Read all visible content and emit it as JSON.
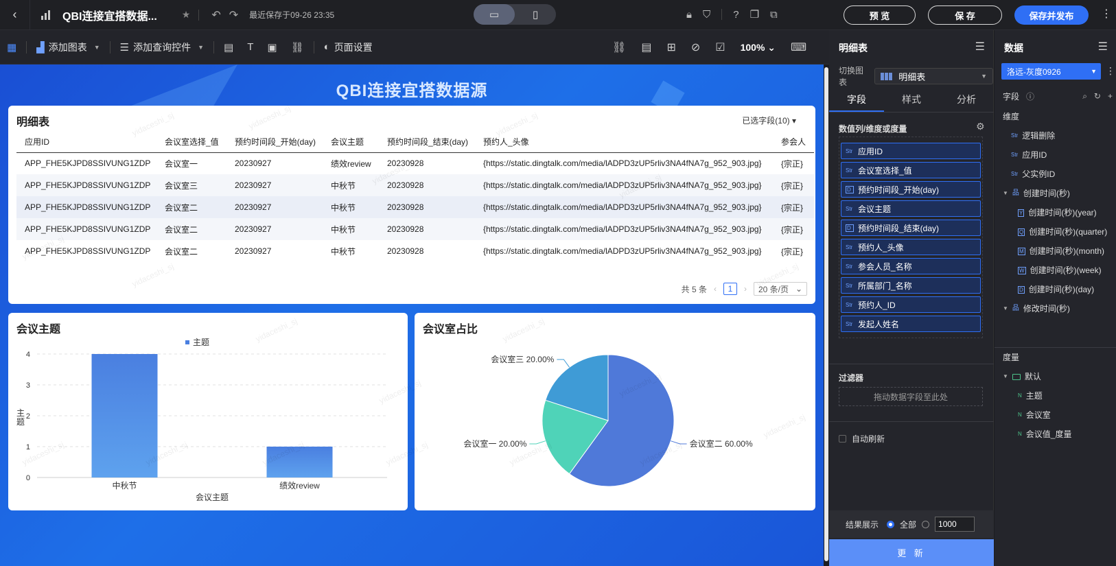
{
  "topbar": {
    "title": "QBI连接宜搭数据...",
    "saved_text": "最近保存于09-26 23:35",
    "preview_label": "预 览",
    "save_label": "保 存",
    "publish_label": "保存并发布"
  },
  "toolbar": {
    "add_chart": "添加图表",
    "add_query": "添加查询控件",
    "page_settings": "页面设置",
    "zoom": "100%"
  },
  "canvas": {
    "title": "QBI连接宜搭数据源",
    "watermark": "yidaceshi_sj"
  },
  "detail_table": {
    "title": "明细表",
    "selected_fields": "已选字段(10)",
    "columns": [
      "应用ID",
      "会议室选择_值",
      "预约时间段_开始(day)",
      "会议主题",
      "预约时间段_结束(day)",
      "预约人_头像",
      "参会人"
    ],
    "rows": [
      [
        "APP_FHE5KJPD8SSIVUNG1ZDP",
        "会议室一",
        "20230927",
        "绩效review",
        "20230928",
        "{https://static.dingtalk.com/media/lADPD3zUP5rliv3NA4fNA7g_952_903.jpg}",
        "{宗正}"
      ],
      [
        "APP_FHE5KJPD8SSIVUNG1ZDP",
        "会议室三",
        "20230927",
        "中秋节",
        "20230928",
        "{https://static.dingtalk.com/media/lADPD3zUP5rliv3NA4fNA7g_952_903.jpg}",
        "{宗正}"
      ],
      [
        "APP_FHE5KJPD8SSIVUNG1ZDP",
        "会议室二",
        "20230927",
        "中秋节",
        "20230928",
        "{https://static.dingtalk.com/media/lADPD3zUP5rliv3NA4fNA7g_952_903.jpg}",
        "{宗正}"
      ],
      [
        "APP_FHE5KJPD8SSIVUNG1ZDP",
        "会议室二",
        "20230927",
        "中秋节",
        "20230928",
        "{https://static.dingtalk.com/media/lADPD3zUP5rliv3NA4fNA7g_952_903.jpg}",
        "{宗正}"
      ],
      [
        "APP_FHE5KJPD8SSIVUNG1ZDP",
        "会议室二",
        "20230927",
        "中秋节",
        "20230928",
        "{https://static.dingtalk.com/media/lADPD3zUP5rliv3NA4fNA7g_952_903.jpg}",
        "{宗正}"
      ]
    ],
    "total_text": "共 5 条",
    "current_page": "1",
    "page_size": "20 条/页"
  },
  "chart_data": [
    {
      "type": "bar",
      "title": "会议主题",
      "categories": [
        "中秋节",
        "绩效review"
      ],
      "series": [
        {
          "name": "主题",
          "values": [
            4,
            1
          ]
        }
      ],
      "xlabel": "会议主题",
      "ylabel": "主题",
      "ylim": [
        0,
        4
      ],
      "yticks": [
        0,
        1,
        2,
        3,
        4
      ],
      "grid": true,
      "legend": "top-center",
      "color": "#4a7fe0"
    },
    {
      "type": "pie",
      "title": "会议室占比",
      "slices": [
        {
          "label": "会议室二",
          "value": 60,
          "display": "会议室二 60.00%",
          "color": "#4f79d9"
        },
        {
          "label": "会议室一",
          "value": 20,
          "display": "会议室一 20.00%",
          "color": "#4fd3b8"
        },
        {
          "label": "会议室三",
          "value": 20,
          "display": "会议室三 20.00%",
          "color": "#3f9bd6"
        }
      ]
    }
  ],
  "config_panel": {
    "title": "明细表",
    "switch_label": "切换图表",
    "chart_type": "明细表",
    "tabs": [
      "字段",
      "样式",
      "分析"
    ],
    "section_fields": "数值列/维度或度量",
    "fields": [
      {
        "type": "Str",
        "name": "应用ID"
      },
      {
        "type": "Str",
        "name": "会议室选择_值"
      },
      {
        "type": "D",
        "name": "预约时间段_开始(day)"
      },
      {
        "type": "Str",
        "name": "会议主题"
      },
      {
        "type": "D",
        "name": "预约时间段_结束(day)"
      },
      {
        "type": "Str",
        "name": "预约人_头像"
      },
      {
        "type": "Str",
        "name": "参会人员_名称"
      },
      {
        "type": "Str",
        "name": "所属部门_名称"
      },
      {
        "type": "Str",
        "name": "预约人_ID"
      },
      {
        "type": "Str",
        "name": "发起人姓名"
      }
    ],
    "filter_label": "过滤器",
    "filter_drop": "拖动数据字段至此处",
    "auto_refresh": "自动刷新",
    "result_label": "结果展示",
    "result_all": "全部",
    "result_limit": "1000",
    "update_label": "更 新"
  },
  "data_panel": {
    "title": "数据",
    "dataset": "洛远-灰度0926",
    "fields_label": "字段",
    "dimension_label": "维度",
    "dimensions": [
      {
        "type": "Str",
        "name": "逻辑删除",
        "level": 1
      },
      {
        "type": "Str",
        "name": "应用ID",
        "level": 1
      },
      {
        "type": "Str",
        "name": "父实例ID",
        "level": 1
      },
      {
        "type": "H",
        "name": "创建时间(秒)",
        "level": 0
      },
      {
        "type": "Y",
        "name": "创建时间(秒)(year)",
        "level": 2
      },
      {
        "type": "Q",
        "name": "创建时间(秒)(quarter)",
        "level": 2
      },
      {
        "type": "M",
        "name": "创建时间(秒)(month)",
        "level": 2
      },
      {
        "type": "W",
        "name": "创建时间(秒)(week)",
        "level": 2
      },
      {
        "type": "D",
        "name": "创建时间(秒)(day)",
        "level": 2
      },
      {
        "type": "H",
        "name": "修改时间(秒)",
        "level": 0
      }
    ],
    "measure_label": "度量",
    "measure_folder": "默认",
    "measures": [
      "主题",
      "会议室",
      "会议值_度量"
    ]
  }
}
